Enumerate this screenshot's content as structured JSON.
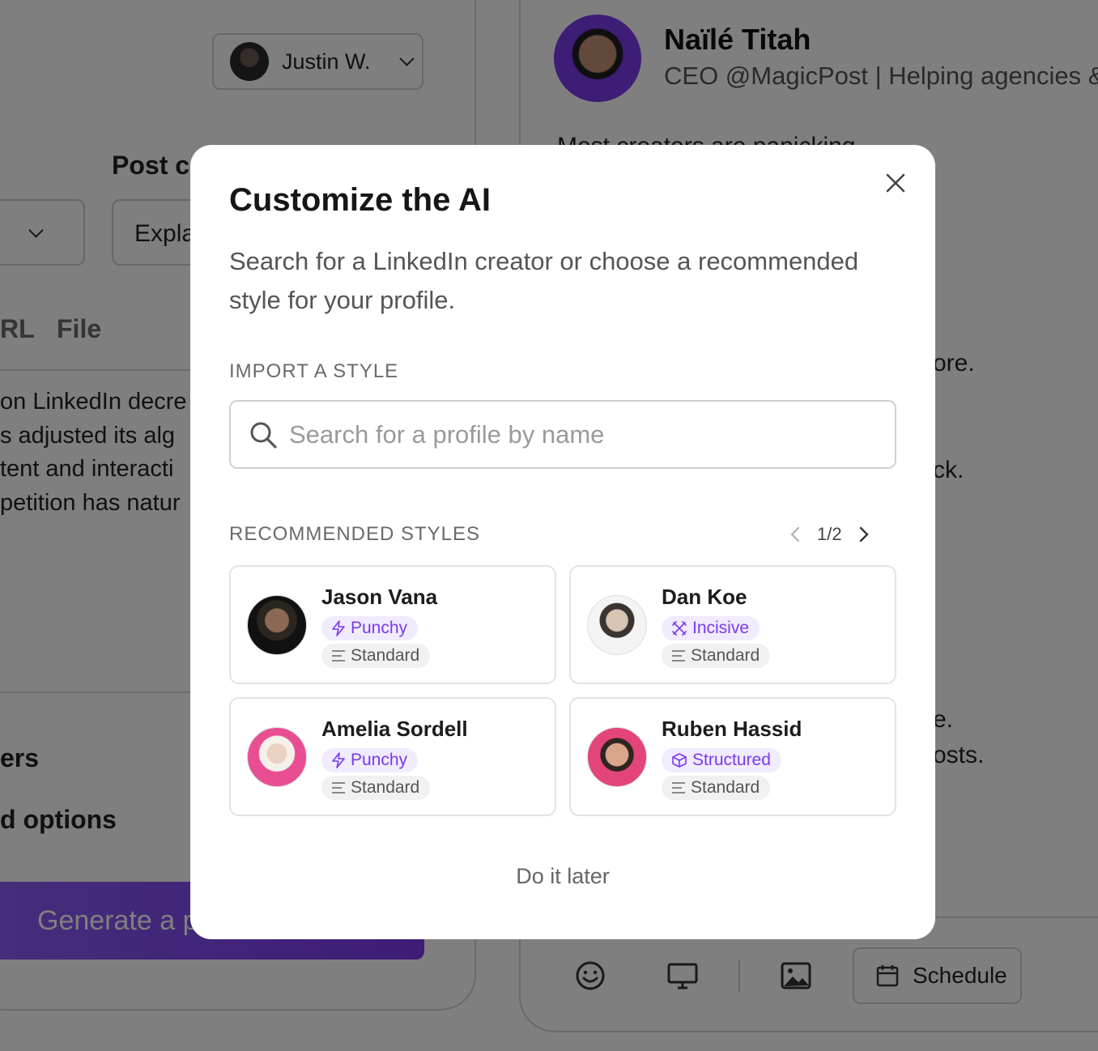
{
  "background": {
    "account_selector": {
      "name": "Justin W."
    },
    "post_controls": {
      "post_label_fragment": "Post c",
      "explain_select_fragment": "Expla",
      "tabs": [
        "RL",
        "File"
      ]
    },
    "source_text_fragments": [
      "on LinkedIn decre",
      "s adjusted its alg",
      "tent and interacti",
      "petition has natur"
    ],
    "settings_fragments": [
      "ers",
      "d options"
    ],
    "generate_button_fragment": "Generate a p",
    "preview": {
      "author_name": "Naïlé Titah",
      "author_headline": "CEO @MagicPost | Helping agencies & t",
      "text_fragments": [
        "Most creators are panicking",
        "ore.",
        "ck.",
        "e.",
        "osts."
      ]
    },
    "toolbar": {
      "icons": [
        "emoji-icon",
        "monitor-icon",
        "image-icon"
      ],
      "schedule_label": "Schedule"
    }
  },
  "modal": {
    "title": "Customize the AI",
    "subtitle": "Search for a LinkedIn creator or choose a recommended style for your profile.",
    "import_label": "IMPORT A STYLE",
    "search": {
      "placeholder": "Search for a profile by name",
      "value": ""
    },
    "recommended_label": "RECOMMENDED STYLES",
    "pagination": {
      "current": 1,
      "total": 2,
      "text": "1/2"
    },
    "styles": [
      {
        "name": "Jason Vana",
        "tone": "Punchy",
        "tone_icon": "bolt-icon",
        "format": "Standard",
        "format_icon": "lines-icon"
      },
      {
        "name": "Dan Koe",
        "tone": "Incisive",
        "tone_icon": "swords-icon",
        "format": "Standard",
        "format_icon": "lines-icon"
      },
      {
        "name": "Amelia Sordell",
        "tone": "Punchy",
        "tone_icon": "bolt-icon",
        "format": "Standard",
        "format_icon": "lines-icon"
      },
      {
        "name": "Ruben Hassid",
        "tone": "Structured",
        "tone_icon": "cube-icon",
        "format": "Standard",
        "format_icon": "lines-icon"
      }
    ],
    "later_label": "Do it later"
  },
  "colors": {
    "accent": "#7c3aed",
    "accent_soft": "#f0ebfd",
    "overlay": "rgba(0,0,0,0.5)"
  }
}
